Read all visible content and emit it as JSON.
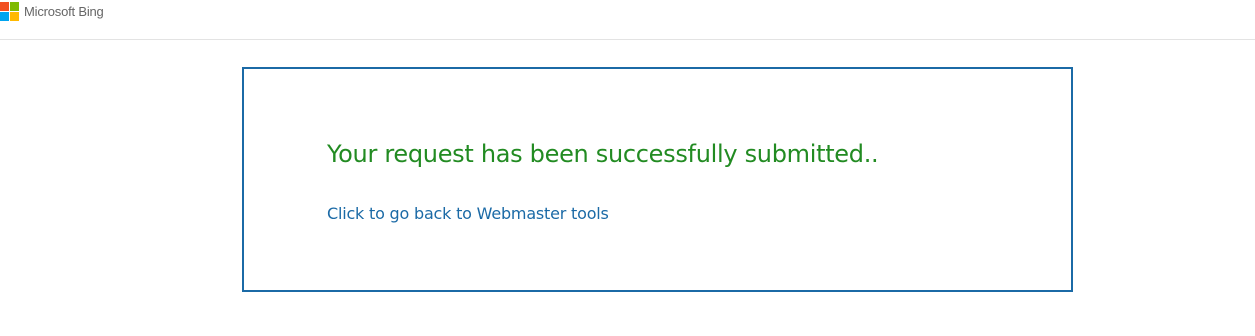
{
  "header": {
    "brand_name": "Microsoft Bing",
    "logo_icon": "microsoft-logo-icon",
    "logo_colors": [
      "#f25022",
      "#7fba00",
      "#00a4ef",
      "#ffb900"
    ]
  },
  "main": {
    "success_message": "Your request has been successfully submitted..",
    "back_link_label": "Click to go back to Webmaster tools"
  },
  "colors": {
    "success": "#228b22",
    "link": "#1b6aa6",
    "card_border": "#1b6aa6"
  }
}
